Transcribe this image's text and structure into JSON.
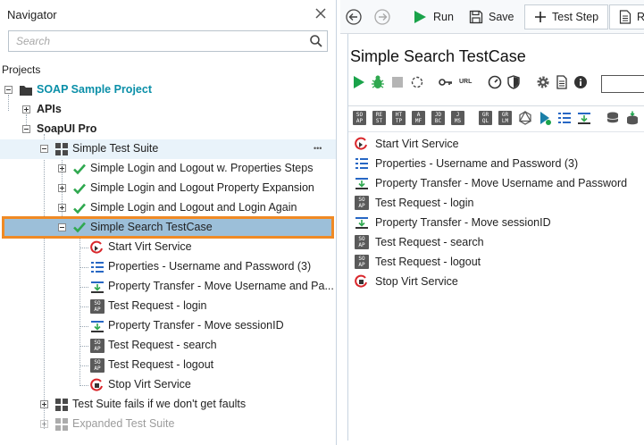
{
  "navigator": {
    "title": "Navigator",
    "search_placeholder": "Search",
    "projects_label": "Projects",
    "tree": {
      "project": "SOAP Sample Project",
      "apis": "APIs",
      "soapui_pro": "SoapUI Pro",
      "suite": "Simple Test Suite",
      "suite_more": "•••",
      "cases": [
        "Simple Login and Logout w. Properties Steps",
        "Simple Login and Logout Property Expansion",
        "Simple Login and Logout and Login Again",
        "Simple Search TestCase"
      ],
      "steps": [
        "Start Virt Service",
        "Properties - Username and Password (3)",
        "Property Transfer - Move Username and Pa...",
        "Test Request - login",
        "Property Transfer - Move sessionID",
        "Test Request - search",
        "Test Request - logout",
        "Stop Virt Service"
      ],
      "other_suites": [
        "Test Suite fails if we don't get faults",
        "Expanded Test Suite"
      ]
    }
  },
  "toolbar": {
    "run": "Run",
    "save": "Save",
    "test_step": "Test Step",
    "cut_label": "Re"
  },
  "testcase": {
    "title": "Simple Search TestCase",
    "url_label": "URL",
    "steps": [
      "Start Virt Service",
      "Properties - Username and Password (3)",
      "Property Transfer - Move Username and Password",
      "Test Request - login",
      "Property Transfer - Move sessionID",
      "Test Request - search",
      "Test Request - logout",
      "Stop Virt Service"
    ],
    "step_types": [
      "virt",
      "props",
      "transfer",
      "soap",
      "transfer",
      "soap",
      "soap",
      "virt"
    ],
    "palette": [
      {
        "top": "SO",
        "bottom": "AP"
      },
      {
        "top": "RE",
        "bottom": "ST"
      },
      {
        "top": "HT",
        "bottom": "TP"
      },
      {
        "top": "A",
        "bottom": "MF"
      },
      {
        "top": "JD",
        "bottom": "BC"
      },
      {
        "top": "J",
        "bottom": "MS"
      },
      {
        "top": "GR",
        "bottom": "QL"
      },
      {
        "top": "GR",
        "bottom": "LM"
      }
    ]
  },
  "colors": {
    "project_teal": "#0a8fa8",
    "check_green": "#2fa84f",
    "selection_bg": "#9cbfd9",
    "selection_border": "#f08a24",
    "run_green": "#1aa34a",
    "virt_red": "#d9262b",
    "props_blue": "#2767c4"
  }
}
